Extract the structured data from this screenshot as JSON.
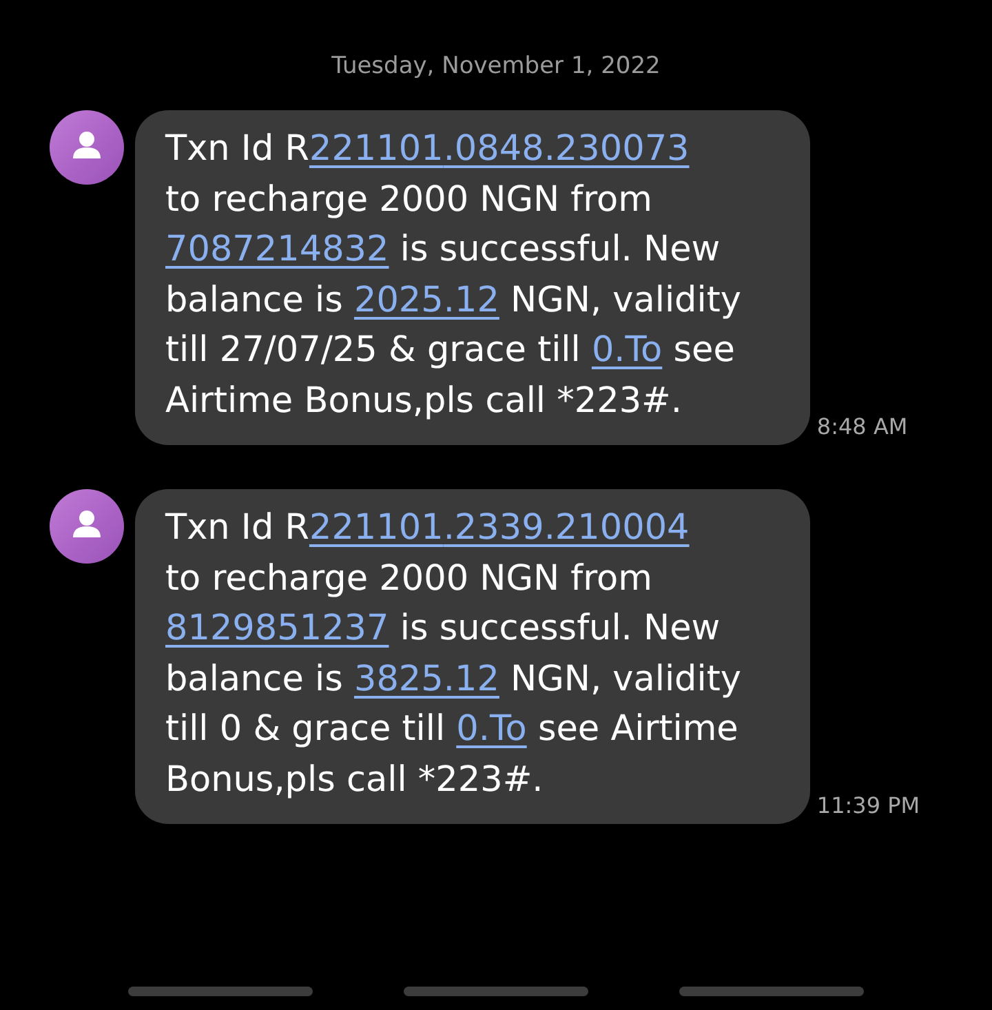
{
  "date_header": "Tuesday, November 1, 2022",
  "messages": [
    {
      "time": "8:48 AM",
      "lines": [
        [
          {
            "kind": "text",
            "text": "Txn Id R"
          },
          {
            "kind": "link",
            "text": "221101"
          },
          {
            "kind": "link",
            "text": ".0848.230073"
          }
        ],
        [
          {
            "kind": "text",
            "text": "to recharge 2000 NGN from"
          }
        ],
        [
          {
            "kind": "link",
            "text": "7087214832"
          },
          {
            "kind": "text",
            "text": " is successful. New"
          }
        ],
        [
          {
            "kind": "text",
            "text": "balance is "
          },
          {
            "kind": "link",
            "text": "2025.12"
          },
          {
            "kind": "text",
            "text": " NGN, validity"
          }
        ],
        [
          {
            "kind": "text",
            "text": "till 27/07/25 & grace till "
          },
          {
            "kind": "link",
            "text": "0.To"
          },
          {
            "kind": "text",
            "text": " see"
          }
        ],
        [
          {
            "kind": "text",
            "text": "Airtime Bonus,pls call *223#."
          }
        ]
      ]
    },
    {
      "time": "11:39 PM",
      "lines": [
        [
          {
            "kind": "text",
            "text": "Txn Id R"
          },
          {
            "kind": "link",
            "text": "221101"
          },
          {
            "kind": "link",
            "text": ".2339.210004"
          }
        ],
        [
          {
            "kind": "text",
            "text": "to recharge 2000 NGN from"
          }
        ],
        [
          {
            "kind": "link",
            "text": "8129851237"
          },
          {
            "kind": "text",
            "text": " is successful. New"
          }
        ],
        [
          {
            "kind": "text",
            "text": "balance is "
          },
          {
            "kind": "link",
            "text": "3825.12"
          },
          {
            "kind": "text",
            "text": " NGN, validity"
          }
        ],
        [
          {
            "kind": "text",
            "text": "till 0 & grace till "
          },
          {
            "kind": "link",
            "text": "0.To"
          },
          {
            "kind": "text",
            "text": " see Airtime"
          }
        ],
        [
          {
            "kind": "text",
            "text": "Bonus,pls call *223#."
          }
        ]
      ]
    }
  ]
}
